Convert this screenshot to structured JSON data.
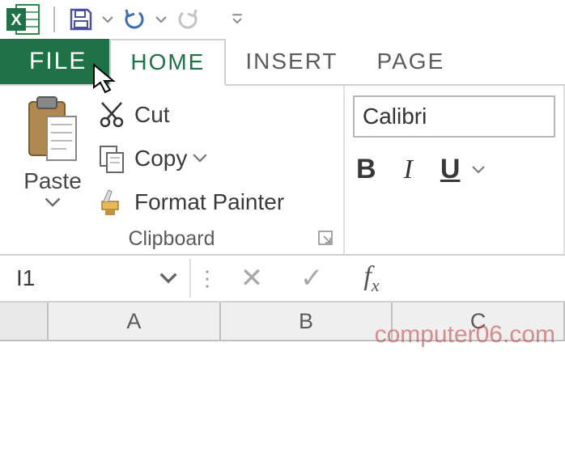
{
  "qat": {
    "app_name": "Excel",
    "save_tooltip": "Save",
    "undo_tooltip": "Undo",
    "redo_tooltip": "Redo"
  },
  "tabs": {
    "file": "FILE",
    "home": "HOME",
    "insert": "INSERT",
    "page": "PAGE"
  },
  "ribbon": {
    "clipboard": {
      "paste_label": "Paste",
      "cut_label": "Cut",
      "copy_label": "Copy",
      "format_painter_label": "Format Painter",
      "group_title": "Clipboard"
    },
    "font": {
      "font_name": "Calibri",
      "bold": "B",
      "italic": "I",
      "underline": "U"
    }
  },
  "formula_bar": {
    "name_box": "I1",
    "cancel": "✕",
    "enter": "✓",
    "fx": "fx"
  },
  "columns": [
    "A",
    "B",
    "C"
  ],
  "watermark": "computer06.com"
}
